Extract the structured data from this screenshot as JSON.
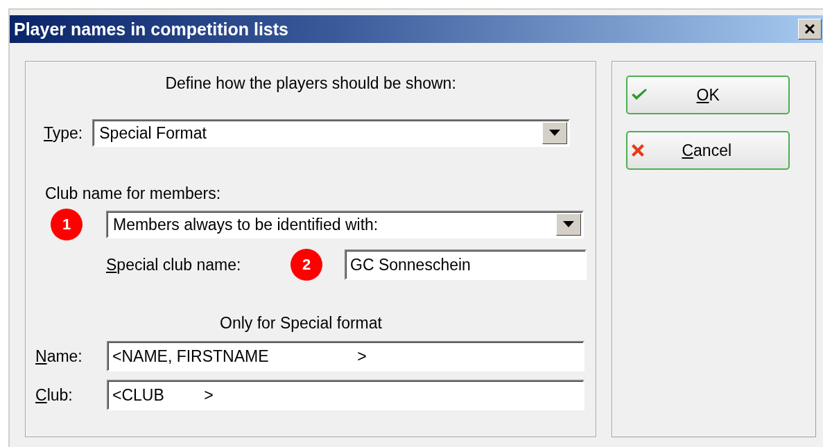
{
  "window": {
    "title": "Player names in competition lists",
    "close": "×"
  },
  "heading": "Define how the players should be shown:",
  "type": {
    "label": "Type:",
    "first_letter_underlined": true,
    "value": "Special Format"
  },
  "club_section": {
    "label": "Club name for members:",
    "badge": "1",
    "value": "Members always to be identified with:"
  },
  "special_club": {
    "label": "Special club name:",
    "first_letter_underlined": true,
    "badge": "2",
    "value": "GC Sonneschein"
  },
  "special_format": {
    "label": "Only for Special format",
    "fields": [
      {
        "label": "Name:",
        "first_letter_underlined": true,
        "value": "<NAME, FIRSTNAME                    >"
      },
      {
        "label": "Club:",
        "first_letter_underlined": true,
        "value": "<CLUB         >"
      }
    ]
  },
  "buttons": [
    {
      "kind": "ok",
      "label": "OK",
      "first_letter_underlined": true
    },
    {
      "kind": "cancel",
      "label": "Cancel",
      "first_letter_underlined": true
    }
  ]
}
